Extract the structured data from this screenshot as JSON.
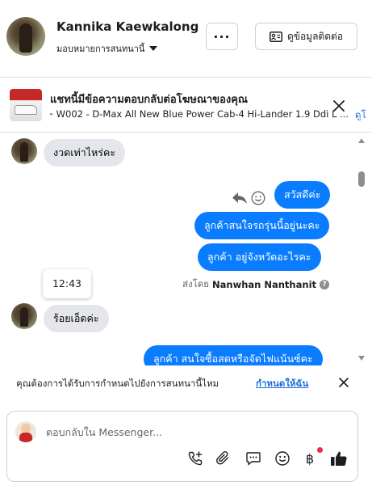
{
  "header": {
    "customer_name": "Kannika Kaewkalong",
    "assign_label": "มอบหมายการสนทนานี้",
    "more_label": "···",
    "contact_button_label": "ดูข้อมูลติดต่อ"
  },
  "ad_banner": {
    "title": "แชทนี้มีข้อความตอบกลับต่อโฆษณาของคุณ",
    "subtitle": "W002 - D-Max All New Blue Power Cab-4 Hi-Lander 1.9 Ddi L ...",
    "link_label": "ดูโ"
  },
  "messages": [
    {
      "direction": "in",
      "text": "งวดเท่าไหร่คะ"
    },
    {
      "direction": "out",
      "text": "สวัสดีค่ะ"
    },
    {
      "direction": "out",
      "text": "ลูกค้าสนใจรถรุ่นนี้อยู่นะคะ"
    },
    {
      "direction": "out",
      "text": "ลูกค้า   อยู่จังหวัดอะไรคะ"
    },
    {
      "direction": "in",
      "text": "ร้อยเอ็ดค่ะ"
    },
    {
      "direction": "out",
      "text": "ลูกค้า สนใจซื้อสดหรือจัดไฟแน้นซ์คะ"
    }
  ],
  "timestamp_tooltip": "12:43",
  "sent_by": {
    "prefix": "ส่งโดย",
    "agent": "Nanwhan Nanthanit",
    "info": "?"
  },
  "suggestion": {
    "text": "คุณต้องการได้รับการกำหนดไปยังการสนทนานี้ไหม",
    "link": "กำหนดให้ฉัน"
  },
  "composer": {
    "placeholder": "ตอบกลับใน Messenger...",
    "currency_symbol": "฿"
  },
  "colors": {
    "outgoing_bubble": "#0a7cff",
    "incoming_bubble": "#e4e6eb",
    "link": "#216fdb",
    "like_icon": "#1c1e21",
    "notification_dot": "#f02849"
  },
  "icons": [
    "more-icon",
    "contact-card-icon",
    "close-icon",
    "reply-icon",
    "smile-icon",
    "info-icon",
    "add-call-icon",
    "attachment-icon",
    "saved-reply-icon",
    "emoji-icon",
    "baht-icon",
    "like-icon"
  ]
}
